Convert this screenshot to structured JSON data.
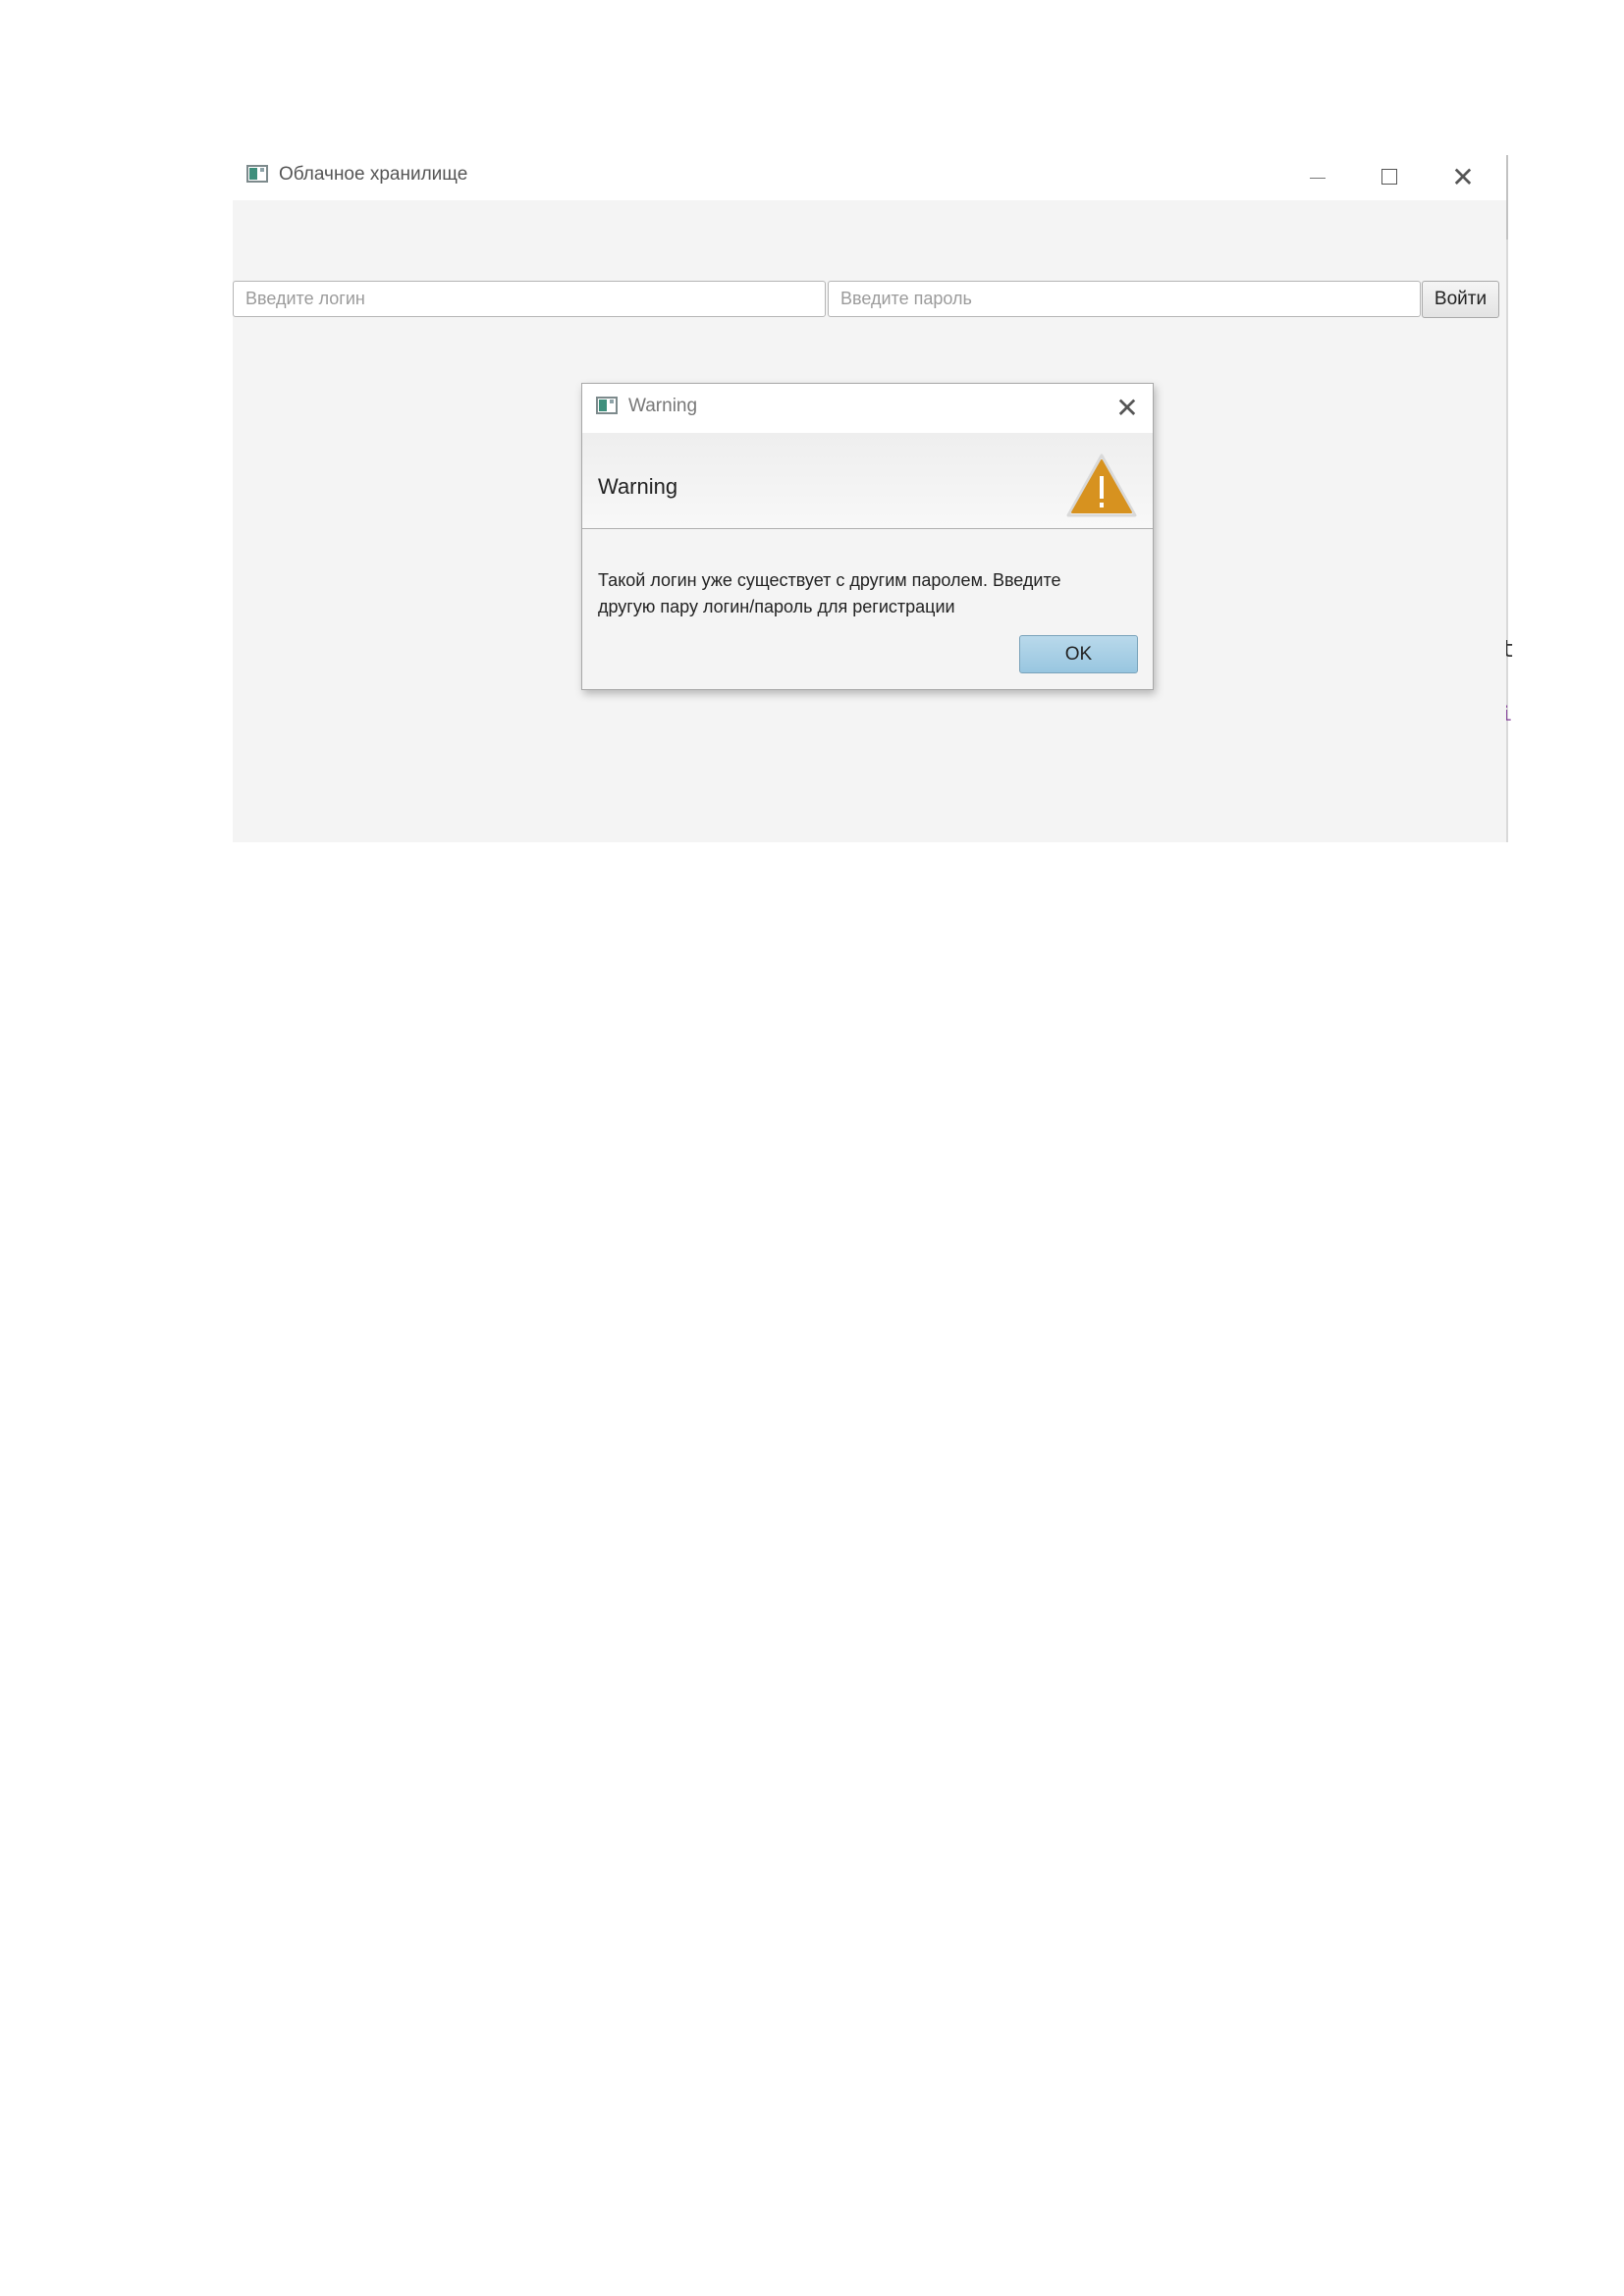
{
  "window": {
    "title": "Облачное хранилище",
    "controls": {
      "minimize": "minimize",
      "maximize": "maximize",
      "close": "close"
    }
  },
  "login_form": {
    "login_placeholder": "Введите логин",
    "password_placeholder": "Введите пароль",
    "submit_label": "Войти"
  },
  "dialog": {
    "title": "Warning",
    "header": "Warning",
    "message_line1": "Такой логин уже существует с другим паролем. Введите",
    "message_line2": "другую пару логин/пароль для регистрации",
    "ok_label": "OK",
    "icon": "warning-triangle-icon"
  },
  "background_fragments": [
    "t",
    "i"
  ],
  "colors": {
    "warning_icon": "#d7921f",
    "ok_button": "#a6cfe6",
    "window_background": "#f4f4f4",
    "fragment_purple": "#8a4a9e"
  }
}
